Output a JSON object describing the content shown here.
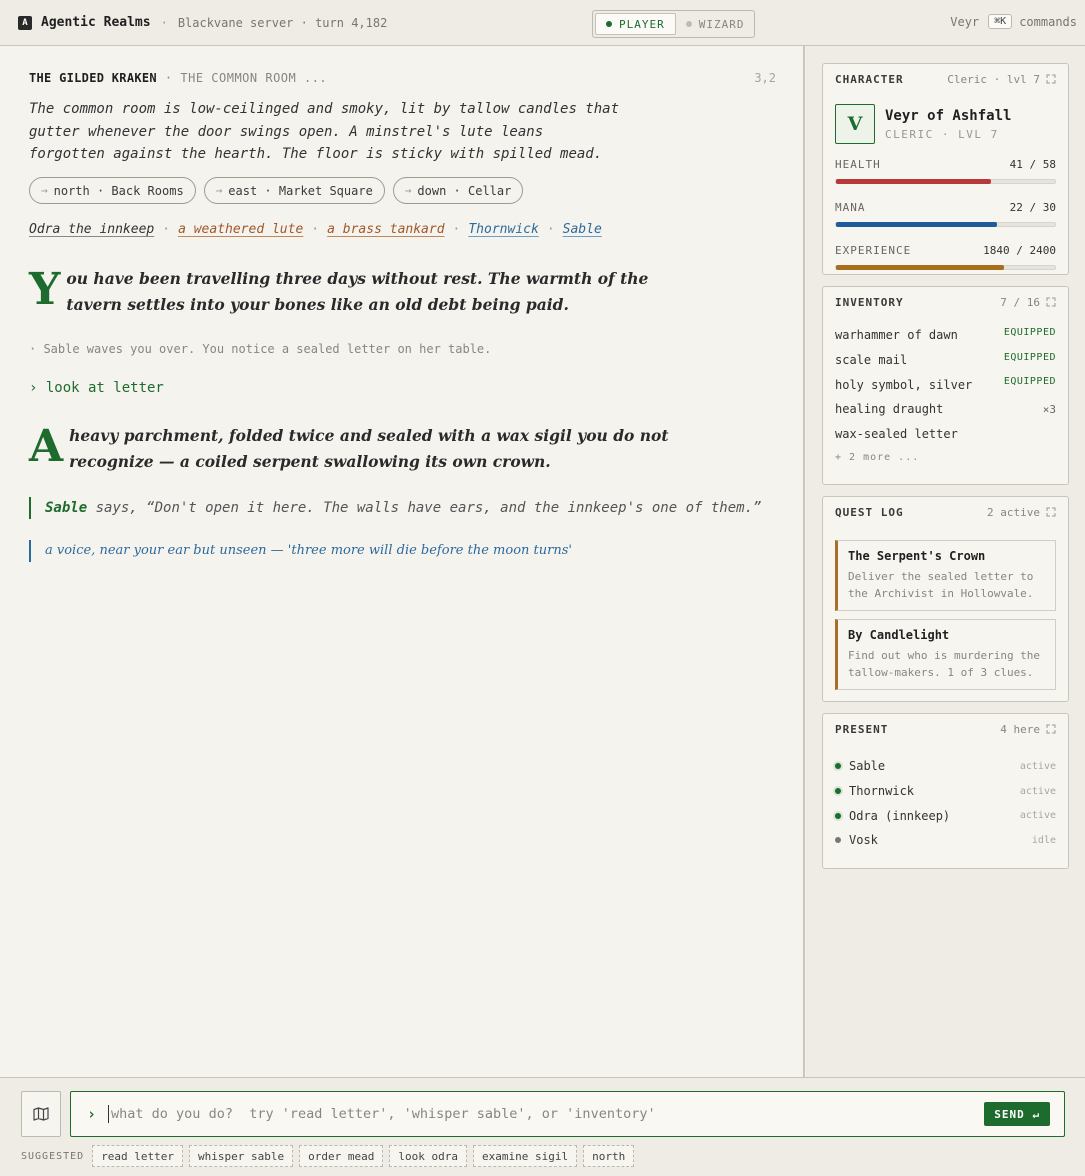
{
  "app": {
    "logo_letter": "A",
    "title": "Agentic Realms",
    "separator": "·",
    "server": "Blackvane server · turn 4,182"
  },
  "mode": {
    "player": "PLAYER",
    "wizard": "WIZARD",
    "selected": "PLAYER"
  },
  "top_right": {
    "user": "Veyr",
    "shortcut": "⌘K",
    "commands_label": "commands"
  },
  "location": {
    "name": "THE GILDED KRAKEN",
    "sub": "· THE COMMON ROOM ...",
    "coords": "3,2",
    "description": "The common room is low-ceilinged and smoky, lit by tallow candles that gutter whenever the door swings open. A minstrel's lute leans forgotten against the hearth. The floor is sticky with spilled mead."
  },
  "exits": [
    {
      "arrow": "→",
      "label": "north · Back Rooms"
    },
    {
      "arrow": "→",
      "label": "east · Market Square"
    },
    {
      "arrow": "→",
      "label": "down · Cellar"
    }
  ],
  "entities": [
    {
      "label": "Odra the innkeep",
      "kind": "person"
    },
    {
      "label": "a weathered lute",
      "kind": "item"
    },
    {
      "label": "a brass tankard",
      "kind": "item"
    },
    {
      "label": "Thornwick",
      "kind": "npc"
    },
    {
      "label": "Sable",
      "kind": "npc"
    }
  ],
  "entity_separator": "·",
  "log": {
    "narration1_cap": "Y",
    "narration1_text": "ou have been travelling three days without rest. The warmth of the tavern settles into your bones like an old debt being paid.",
    "event": "· Sable waves you over. You notice a sealed letter on her table.",
    "command": "› look at letter",
    "narration2_cap": "A",
    "narration2_text": "heavy parchment, folded twice and sealed with a wax sigil you do not recognize — a coiled serpent swallowing its own crown.",
    "speech_speaker": "Sable",
    "speech_text": " says, “Don't open it here. The walls have ears, and the innkeep's one of them.”",
    "whisper": "a voice, near your ear but unseen — 'three more will die before the moon turns'"
  },
  "character": {
    "heading": "CHARACTER",
    "meta": "Cleric · lvl 7",
    "avatar_letter": "V",
    "name": "Veyr of Ashfall",
    "class_line": "CLERIC · LVL 7",
    "stats": [
      {
        "label": "HEALTH",
        "value": "41 / 58",
        "fraction": 0.707,
        "color": "#b8393a"
      },
      {
        "label": "MANA",
        "value": "22 / 30",
        "fraction": 0.733,
        "color": "#1f5c9b"
      },
      {
        "label": "EXPERIENCE",
        "value": "1840 / 2400",
        "fraction": 0.767,
        "color": "#a86e1a"
      }
    ]
  },
  "inventory": {
    "heading": "INVENTORY",
    "meta": "7 / 16",
    "items": [
      {
        "name": "warhammer of dawn",
        "tag": "EQUIPPED",
        "count": ""
      },
      {
        "name": "scale mail",
        "tag": "EQUIPPED",
        "count": ""
      },
      {
        "name": "holy symbol, silver",
        "tag": "EQUIPPED",
        "count": ""
      },
      {
        "name": "healing draught",
        "tag": "",
        "count": "×3"
      },
      {
        "name": "wax-sealed letter",
        "tag": "",
        "count": ""
      }
    ],
    "more": "+ 2 more ..."
  },
  "quests": {
    "heading": "QUEST LOG",
    "meta": "2 active",
    "items": [
      {
        "title": "The Serpent's Crown",
        "desc": "Deliver the sealed letter to the Archivist in Hollowvale."
      },
      {
        "title": "By Candlelight",
        "desc": "Find out who is murdering the tallow-makers. 1 of 3 clues."
      }
    ]
  },
  "present": {
    "heading": "PRESENT",
    "meta": "4 here",
    "items": [
      {
        "name": "Sable",
        "status": "active"
      },
      {
        "name": "Thornwick",
        "status": "active"
      },
      {
        "name": "Odra (innkeep)",
        "status": "active"
      },
      {
        "name": "Vosk",
        "status": "idle"
      }
    ]
  },
  "input": {
    "prompt": "›",
    "placeholder": "what do you do?  try 'read letter', 'whisper sable', or 'inventory'",
    "send_label": "SEND ↵"
  },
  "suggested": {
    "label": "SUGGESTED",
    "chips": [
      "read letter",
      "whisper sable",
      "order mead",
      "look odra",
      "examine sigil",
      "north"
    ]
  },
  "colors": {
    "accent": "#1e6b2e",
    "item": "#a0582a",
    "npc": "#2d6a9c",
    "quest": "#a86e2a"
  },
  "icons": {
    "map": "map-icon",
    "expand": "expand-icon"
  }
}
